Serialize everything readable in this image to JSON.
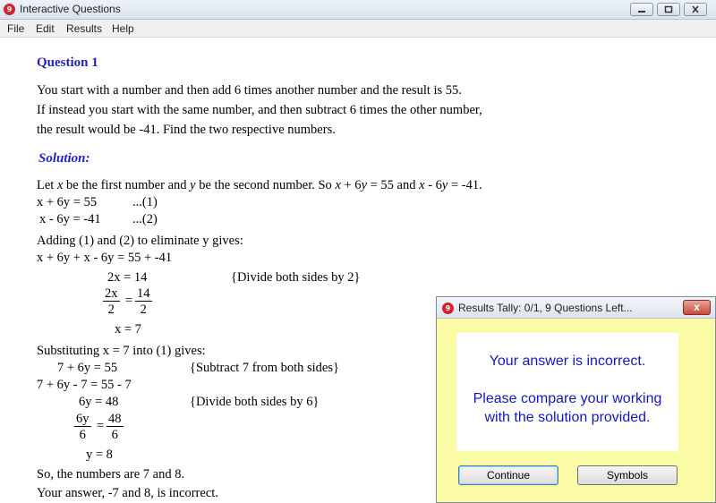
{
  "window": {
    "title": "Interactive Questions",
    "app_icon_glyph": "9"
  },
  "menu": [
    "File",
    "Edit",
    "Results",
    "Help"
  ],
  "question": {
    "heading": "Question 1",
    "lines": [
      "You start with a number and then add 6 times another number and the result is 55.",
      "If instead you start with the same number, and then subtract 6 times the other number,",
      "the result would be -41.  Find the two respective numbers."
    ]
  },
  "solution": {
    "heading": "Solution:",
    "intro_html": "Let <i>x</i> be the first number and <i>y</i> be the second number.  So <i>x</i> + 6<i>y</i> = 55 and <i>x</i> - 6<i>y</i> = -41.",
    "eq1": "x + 6y = 55",
    "eq1_tag": "...(1)",
    "eq2": "x - 6y = -41",
    "eq2_tag": "...(2)",
    "adding": "Adding (1) and (2) to eliminate y gives:",
    "sum": "x + 6y + x - 6y = 55 + -41",
    "step_2x": "2x = 14",
    "note_div2": "{Divide both sides by 2}",
    "frac1_num": "2x",
    "frac1_den": "2",
    "frac2_num": "14",
    "frac2_den": "2",
    "x_result": "x = 7",
    "substituting": "Substituting x = 7 into (1) gives:",
    "sub1": "7 + 6y = 55",
    "note_sub7": "{Subtract 7 from both sides}",
    "sub2": "7 + 6y - 7 = 55 - 7",
    "sub3": "6y = 48",
    "note_div6": "{Divide both sides by 6}",
    "frac3_num": "6y",
    "frac3_den": "6",
    "frac4_num": "48",
    "frac4_den": "6",
    "y_result": "y = 8",
    "conclusion": "So, the numbers are 7 and 8.",
    "your_answer": "Your answer, -7 and 8, is incorrect."
  },
  "popup": {
    "title": "Results Tally:  0/1, 9 Questions Left...",
    "close_glyph": "x",
    "message1": "Your answer is incorrect.",
    "message2": "Please compare your working",
    "message3": "with the solution provided.",
    "continue_label": "Continue",
    "symbols_label": "Symbols"
  }
}
